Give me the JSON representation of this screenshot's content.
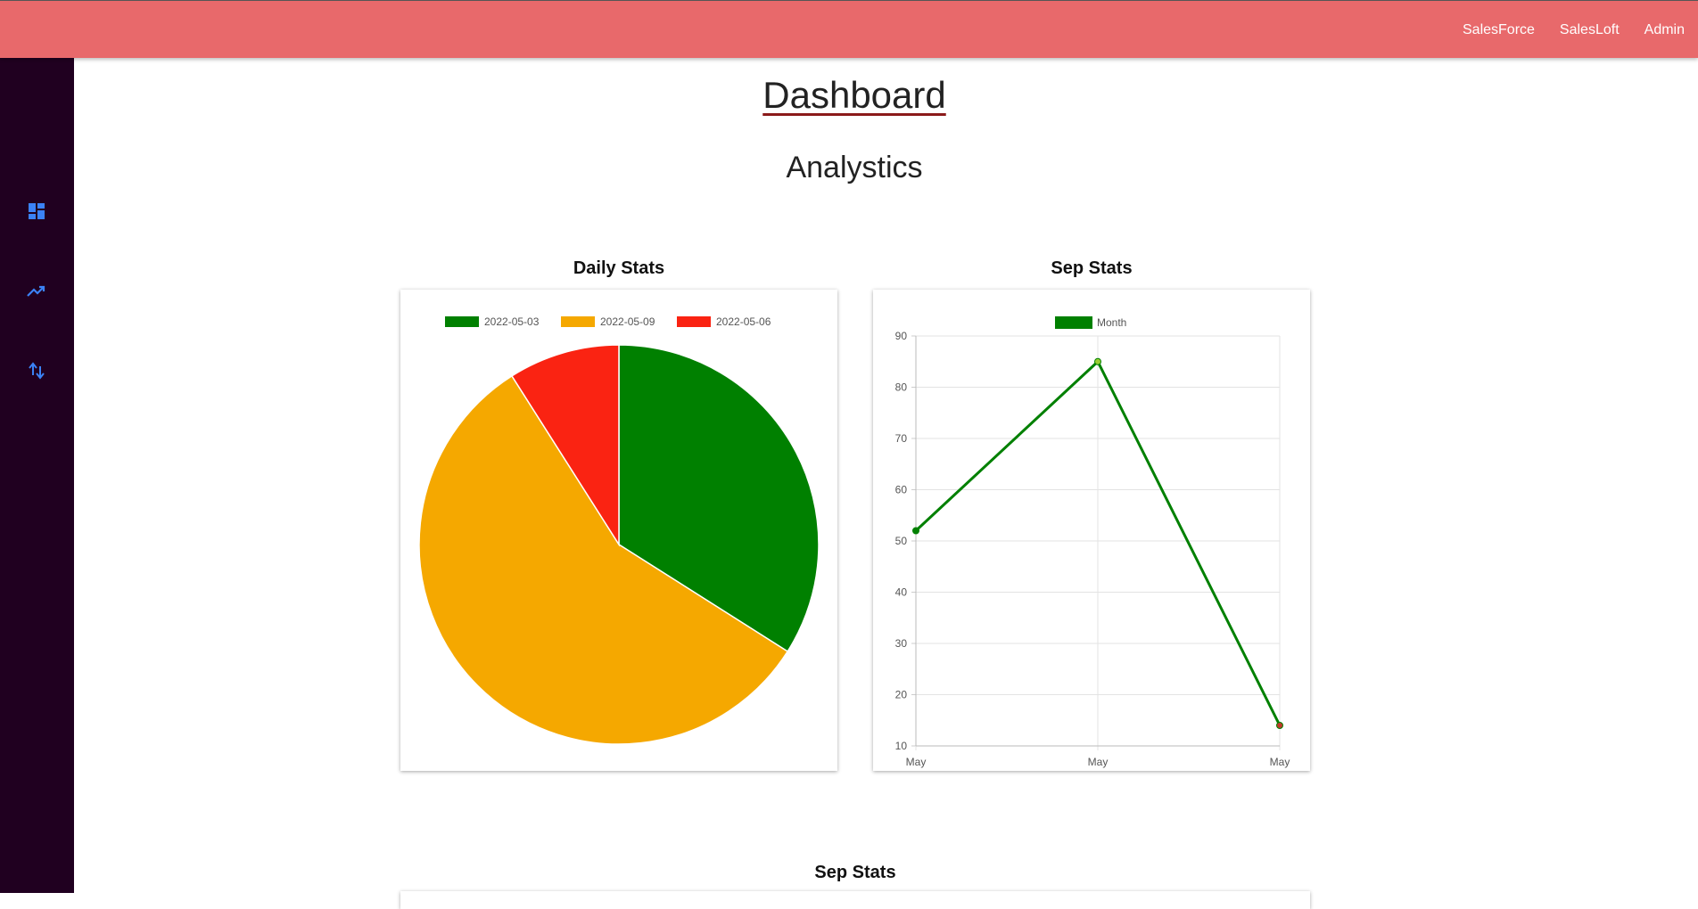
{
  "topnav": {
    "items": [
      "SalesForce",
      "SalesLoft",
      "Admin"
    ]
  },
  "sidebar": {
    "icons": [
      "dashboard-icon",
      "trending-up-icon",
      "swap-vert-icon"
    ],
    "icon_color": "#3b82f6"
  },
  "page": {
    "title": "Dashboard",
    "subtitle": "Analystics"
  },
  "cards": {
    "daily_title": "Daily Stats",
    "sep_title": "Sep Stats",
    "bottom_title": "Sep Stats"
  },
  "chart_data": [
    {
      "type": "pie",
      "title": "Daily Stats",
      "categories": [
        "2022-05-03",
        "2022-05-09",
        "2022-05-06"
      ],
      "values": [
        34,
        57,
        9
      ],
      "colors": [
        "#008000",
        "#f5a800",
        "#fa2312"
      ],
      "legend": "top"
    },
    {
      "type": "line",
      "title": "Sep Stats",
      "categories": [
        "May",
        "May",
        "May"
      ],
      "series": [
        {
          "name": "Month",
          "values": [
            52,
            85,
            14
          ],
          "color": "#008000"
        }
      ],
      "ylim": [
        10,
        90
      ],
      "yticks": [
        10,
        20,
        30,
        40,
        50,
        60,
        70,
        80,
        90
      ],
      "point_colors": [
        "#008000",
        "#9acd32",
        "#c0392b"
      ],
      "grid": true,
      "legend": "top"
    }
  ]
}
